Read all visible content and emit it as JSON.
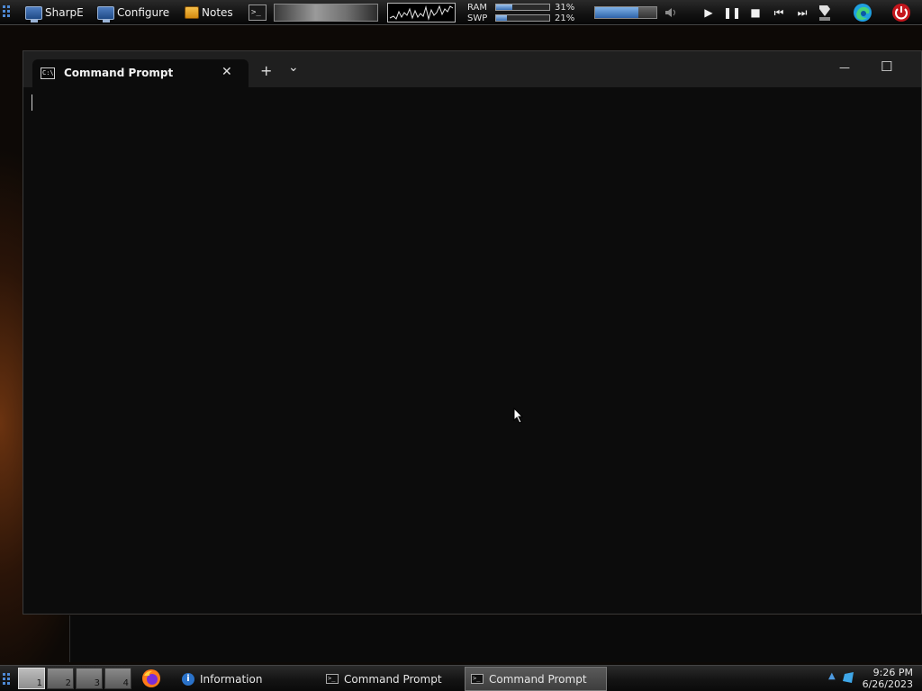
{
  "topbar": {
    "launchers": [
      {
        "label": "SharpE",
        "icon": "monitor-icon"
      },
      {
        "label": "Configure",
        "icon": "monitor-icon"
      },
      {
        "label": "Notes",
        "icon": "notes-icon"
      }
    ],
    "terminal_glyph": ">_",
    "ram_label": "RAM",
    "ram_percent": "31%",
    "ram_fraction": 0.31,
    "swp_label": "SWP",
    "swp_percent": "21%",
    "swp_fraction": 0.21,
    "volume_fraction": 0.7,
    "media": [
      "play-icon",
      "pause-icon",
      "stop-icon",
      "previous-icon",
      "next-icon"
    ],
    "tray_icons": [
      "shortcut-icon",
      "edge-icon",
      "power-icon"
    ]
  },
  "window": {
    "tab_title": "Command Prompt",
    "tab_icon": "C:\\",
    "new_tab": "+",
    "dropdown": "⌄",
    "close_tab": "✕",
    "minimize": "—",
    "maximize": "☐"
  },
  "taskbar": {
    "workspaces": [
      "1",
      "2",
      "3",
      "4"
    ],
    "active_workspace": "1",
    "tasks": [
      {
        "label": "Information",
        "icon": "info-icon",
        "active": false
      },
      {
        "label": "Command Prompt",
        "icon": "prompt-icon",
        "active": false
      },
      {
        "label": "Command Prompt",
        "icon": "prompt-icon",
        "active": true
      }
    ],
    "time": "9:26 PM",
    "date": "6/26/2023"
  },
  "colors": {
    "accent": "#3a70b6",
    "terminal_bg": "#0c0c0c",
    "titlebar_bg": "#1f1f1f"
  }
}
